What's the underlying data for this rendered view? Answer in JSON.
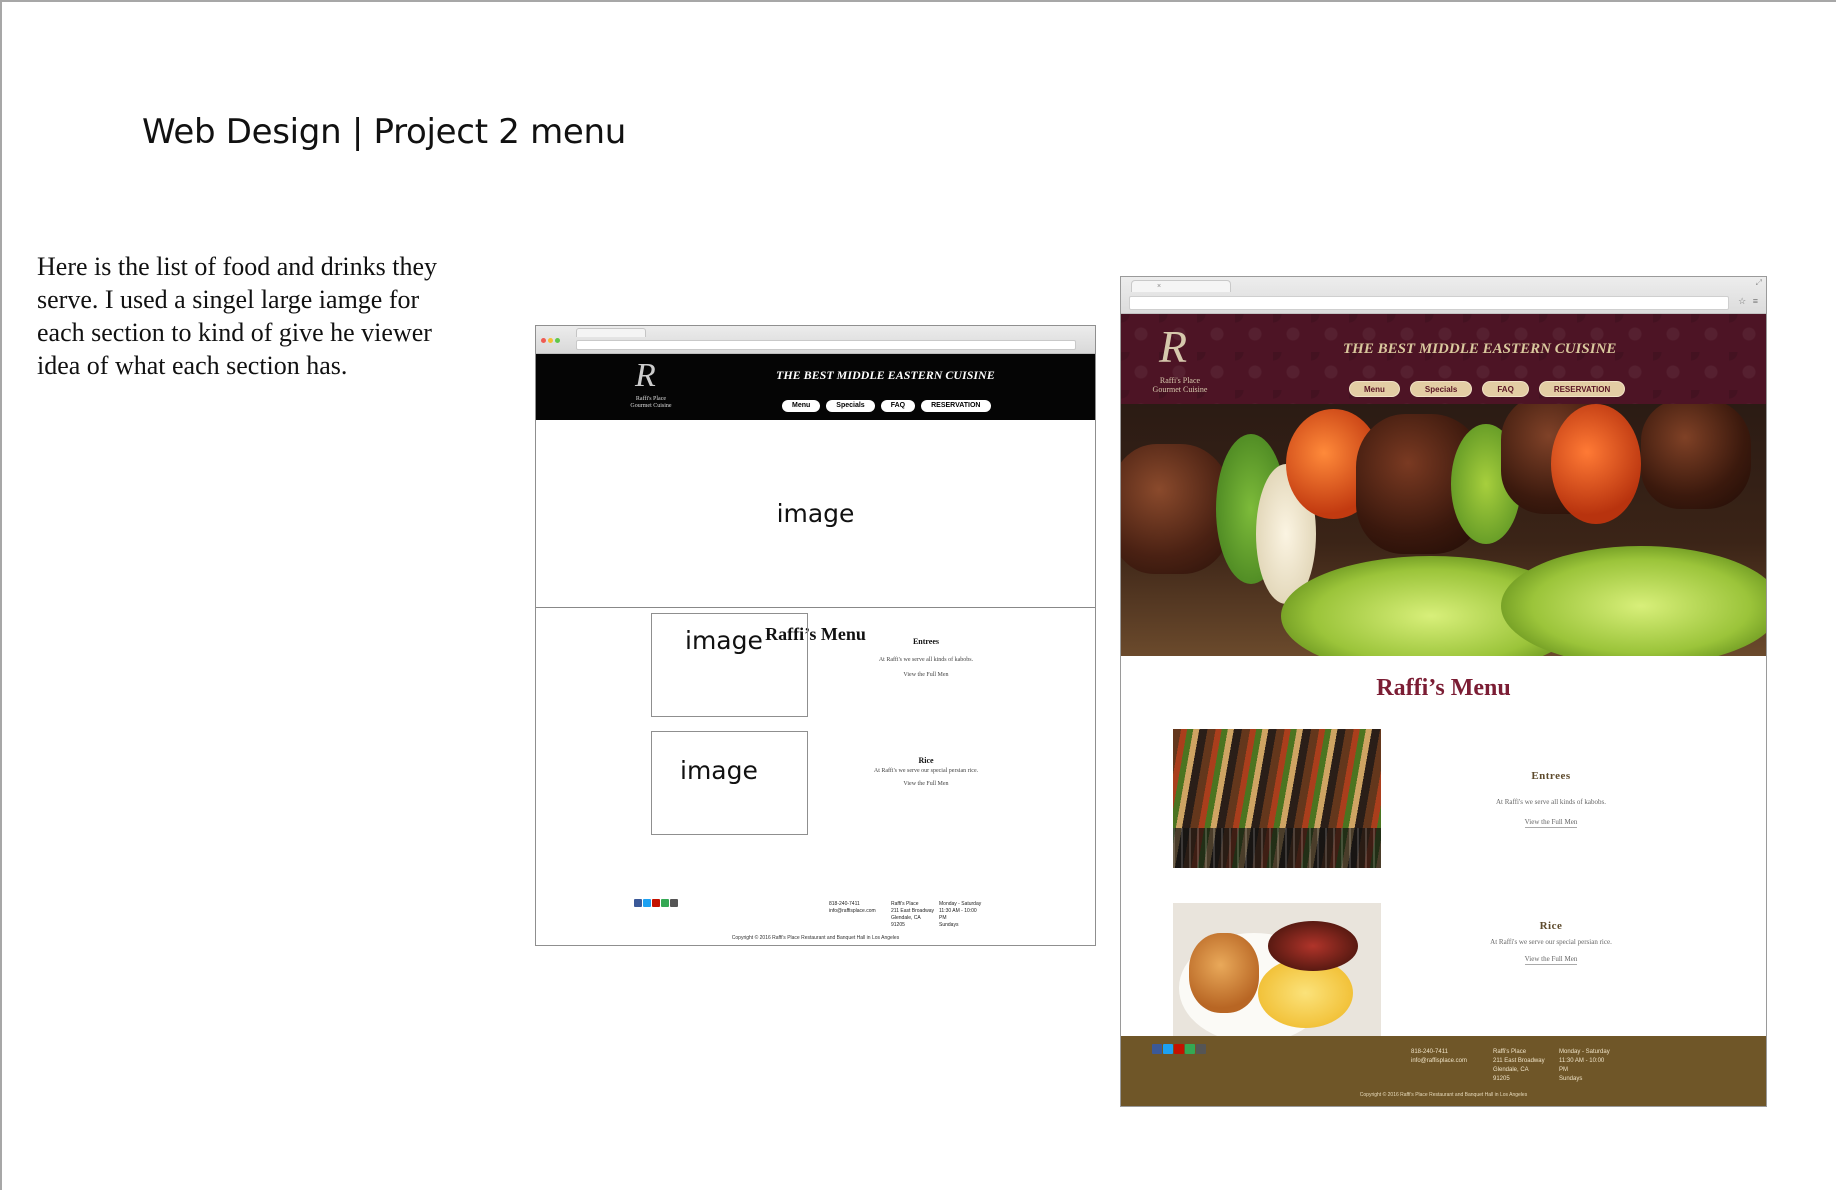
{
  "slide": {
    "title": "Web Design | Project 2 menu",
    "description": "Here is the list of food and drinks they serve. I used a singel large iamge for each section to kind of give he viewer idea of what each section has."
  },
  "site": {
    "logo_letter": "R",
    "logo_name": "Raffi's Place",
    "logo_sub": "Gourmet Cuisine",
    "tagline": "THE BEST MIDDLE EASTERN CUISINE",
    "nav": [
      "Menu",
      "Specials",
      "FAQ",
      "RESERVATION"
    ],
    "menu_title": "Raffi’s Menu",
    "sections": [
      {
        "heading": "Entrees",
        "text": "At Raffi's we serve all kinds of kabobs.",
        "link": "View the Full Men"
      },
      {
        "heading": "Rice",
        "text": "At Raffi's we serve our special persian rice.",
        "link": "View the Full Men"
      }
    ],
    "footer": {
      "contact": [
        "818-240-7411",
        "info@raffisplace.com"
      ],
      "address": [
        "Raffi's Place",
        "211 East Broadway",
        "Glendale, CA",
        "91205"
      ],
      "hours": [
        "Monday - Saturday",
        "11:30 AM - 10:00",
        "PM",
        "Sundays"
      ],
      "copyright": "Copyright © 2016 Raffi's Place Restaurant and Banquet Hall in Los Angeles"
    }
  },
  "wireframe": {
    "placeholder": "image"
  },
  "colors": {
    "mockup_header": "#4d1425",
    "mockup_nav_button": "#e3cda4",
    "mockup_menu_title": "#7b1d34",
    "mockup_footer": "#6f5628",
    "wireframe_header": "#050505"
  },
  "icons": [
    "facebook-icon",
    "twitter-icon",
    "yelp-icon",
    "tripadvisor-icon",
    "instagram-icon"
  ]
}
